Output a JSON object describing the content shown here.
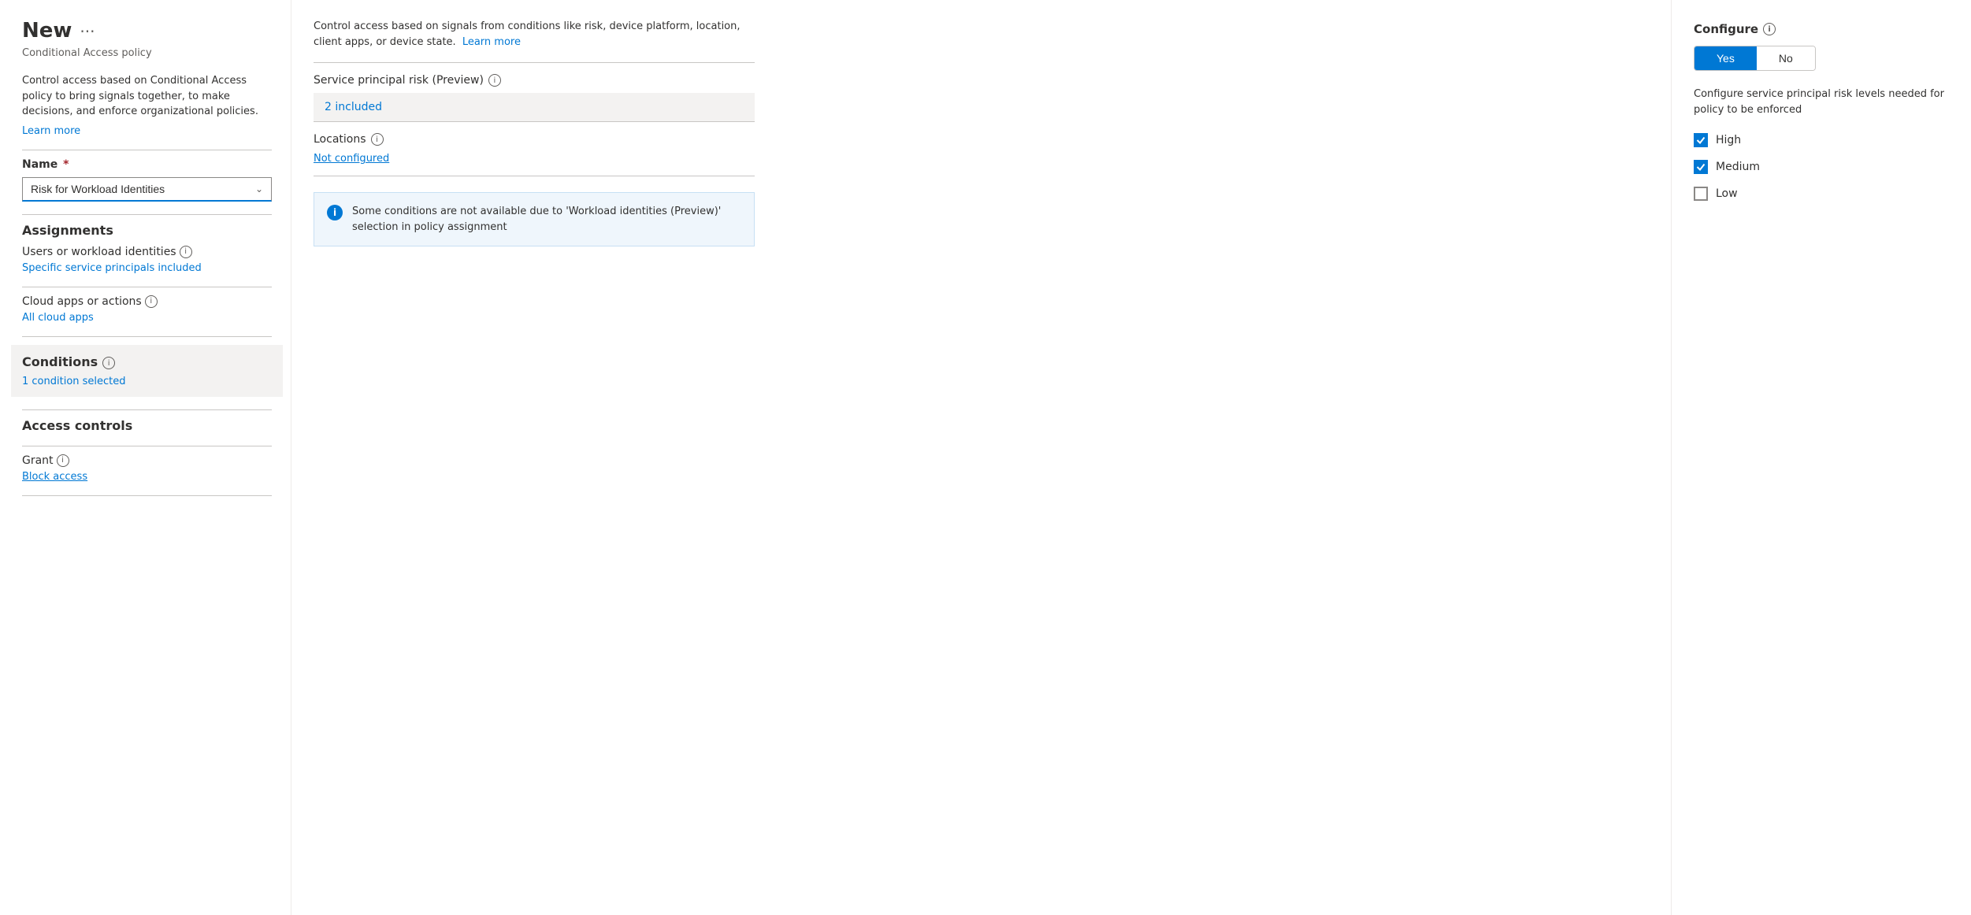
{
  "leftCol": {
    "title": "New",
    "subtitle": "Conditional Access policy",
    "description": "Control access based on Conditional Access policy to bring signals together, to make decisions, and enforce organizational policies.",
    "learnMoreLink": "Learn more",
    "nameLabel": "Name",
    "nameValue": "Risk for Workload Identities",
    "assignmentsHeading": "Assignments",
    "usersLabel": "Users or workload identities",
    "usersValue": "Specific service principals included",
    "cloudAppsLabel": "Cloud apps or actions",
    "cloudAppsValue": "All cloud apps",
    "conditionsLabel": "Conditions",
    "conditionsValue": "1 condition selected",
    "accessControlsHeading": "Access controls",
    "grantLabel": "Grant",
    "grantValue": "Block access"
  },
  "middleCol": {
    "description": "Control access based on signals from conditions like risk, device platform, location, client apps, or device state.",
    "learnMoreLink": "Learn more",
    "servicePrincipalLabel": "Service principal risk (Preview)",
    "servicePrincipalValue": "2 included",
    "locationsLabel": "Locations",
    "locationsValue": "Not configured",
    "infoBannerText": "Some conditions are not available due to 'Workload identities (Preview)' selection in policy assignment"
  },
  "rightPanel": {
    "configureLabel": "Configure",
    "yesLabel": "Yes",
    "noLabel": "No",
    "configureDesc": "Configure service principal risk levels needed for policy to be enforced",
    "checkboxes": [
      {
        "label": "High",
        "checked": true
      },
      {
        "label": "Medium",
        "checked": true
      },
      {
        "label": "Low",
        "checked": false
      }
    ]
  }
}
